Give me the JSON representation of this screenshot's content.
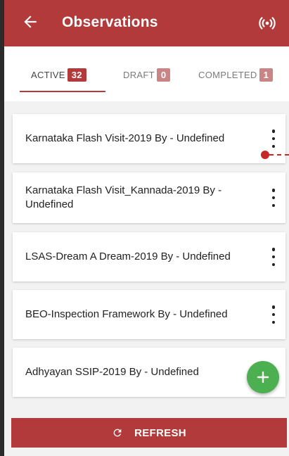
{
  "header": {
    "title": "Observations",
    "back_icon": "arrow-left-icon",
    "action_icon": "broadcast-signal-icon",
    "color": "#b23a3a"
  },
  "tabs": [
    {
      "label": "ACTIVE",
      "count": "32",
      "selected": true
    },
    {
      "label": "DRAFT",
      "count": "0",
      "selected": false
    },
    {
      "label": "COMPLETED",
      "count": "1",
      "selected": false
    }
  ],
  "observations": [
    {
      "title": "Karnataka Flash Visit-2019 By - Undefined"
    },
    {
      "title": "Karnataka Flash Visit_Kannada-2019 By - Undefined"
    },
    {
      "title": "LSAS-Dream A Dream-2019 By - Undefined"
    },
    {
      "title": "BEO-Inspection Framework By - Undefined"
    },
    {
      "title": "Adhyayan SSIP-2019 By - Undefined"
    }
  ],
  "fab": {
    "icon": "plus-icon",
    "color": "#4caf50"
  },
  "footer": {
    "refresh_label": "REFRESH",
    "refresh_icon": "refresh-icon"
  }
}
